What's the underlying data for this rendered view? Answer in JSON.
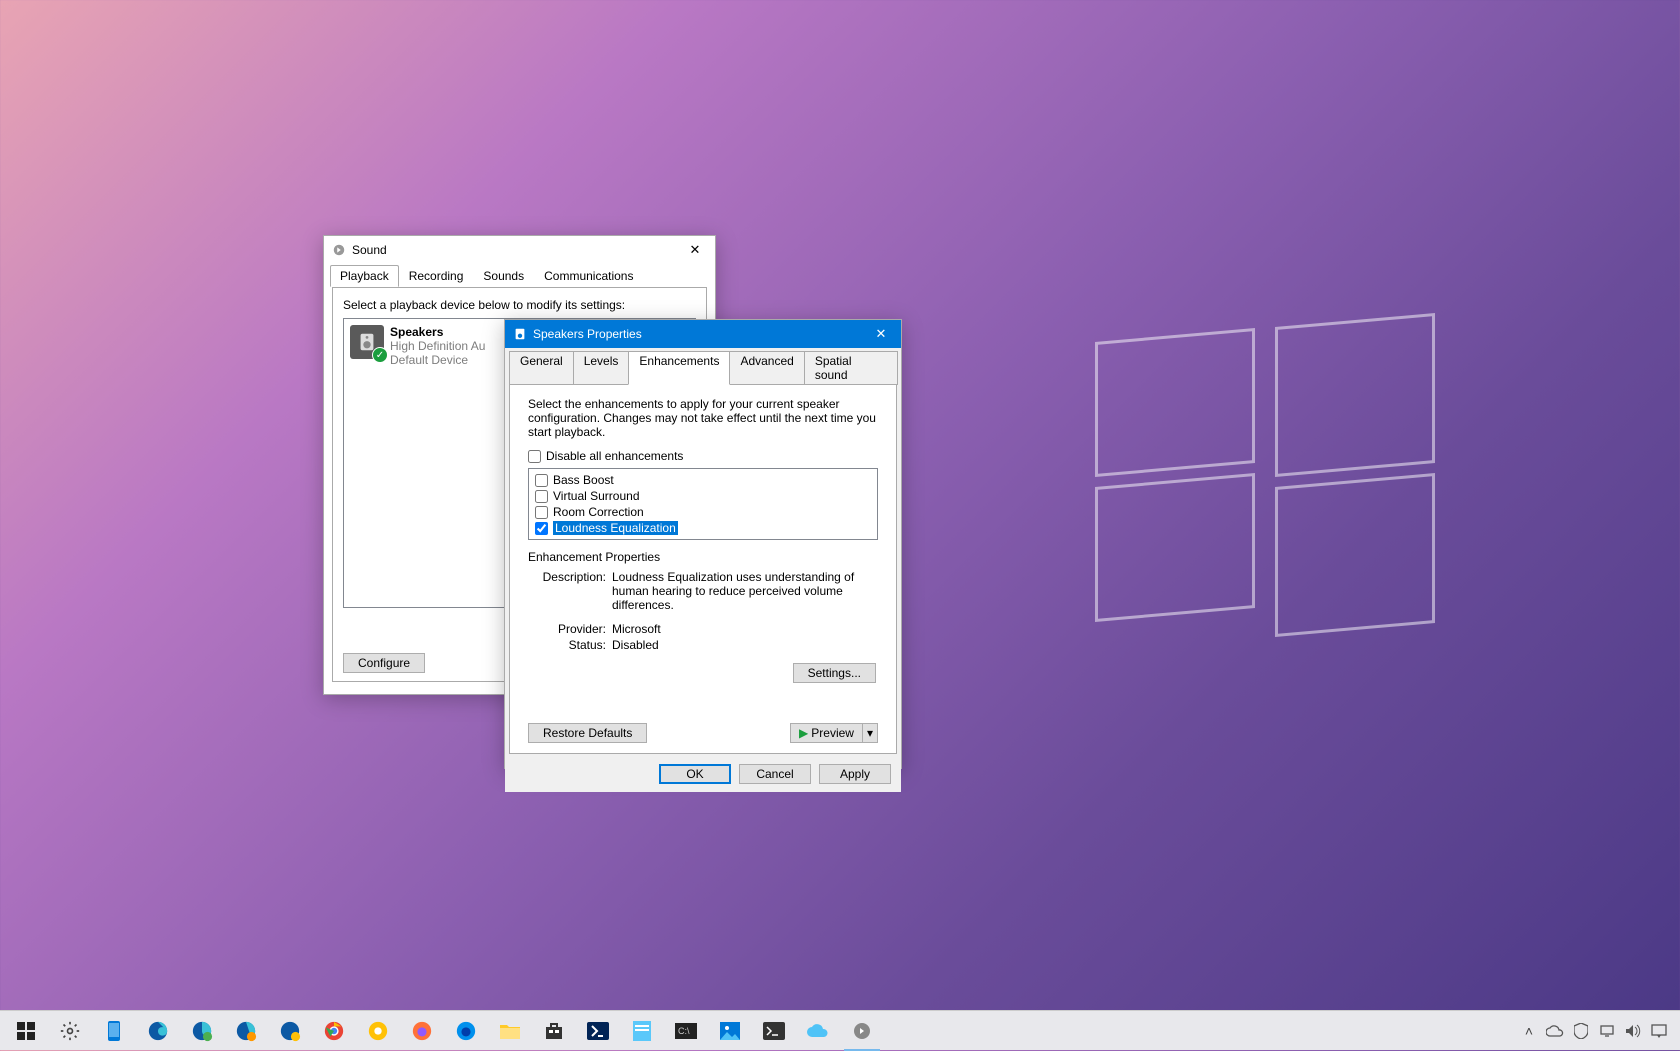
{
  "sound": {
    "title": "Sound",
    "tabs": [
      "Playback",
      "Recording",
      "Sounds",
      "Communications"
    ],
    "active_tab": 0,
    "hint": "Select a playback device below to modify its settings:",
    "device": {
      "name": "Speakers",
      "line2": "High Definition Au",
      "line3": "Default Device"
    },
    "configure": "Configure"
  },
  "props": {
    "title": "Speakers Properties",
    "tabs": [
      "General",
      "Levels",
      "Enhancements",
      "Advanced",
      "Spatial sound"
    ],
    "active_tab": 2,
    "desc": "Select the enhancements to apply for your current speaker configuration. Changes may not take effect until the next time you start playback.",
    "disable_all": "Disable all enhancements",
    "enhancements": [
      {
        "label": "Bass Boost",
        "checked": false,
        "selected": false
      },
      {
        "label": "Virtual Surround",
        "checked": false,
        "selected": false
      },
      {
        "label": "Room Correction",
        "checked": false,
        "selected": false
      },
      {
        "label": "Loudness Equalization",
        "checked": true,
        "selected": true
      }
    ],
    "group_title": "Enhancement Properties",
    "description_label": "Description:",
    "description_value": "Loudness Equalization uses understanding of human hearing to reduce perceived volume differences.",
    "provider_label": "Provider:",
    "provider_value": "Microsoft",
    "status_label": "Status:",
    "status_value": "Disabled",
    "settings_btn": "Settings...",
    "restore": "Restore Defaults",
    "preview": "Preview",
    "ok": "OK",
    "cancel": "Cancel",
    "apply": "Apply"
  }
}
